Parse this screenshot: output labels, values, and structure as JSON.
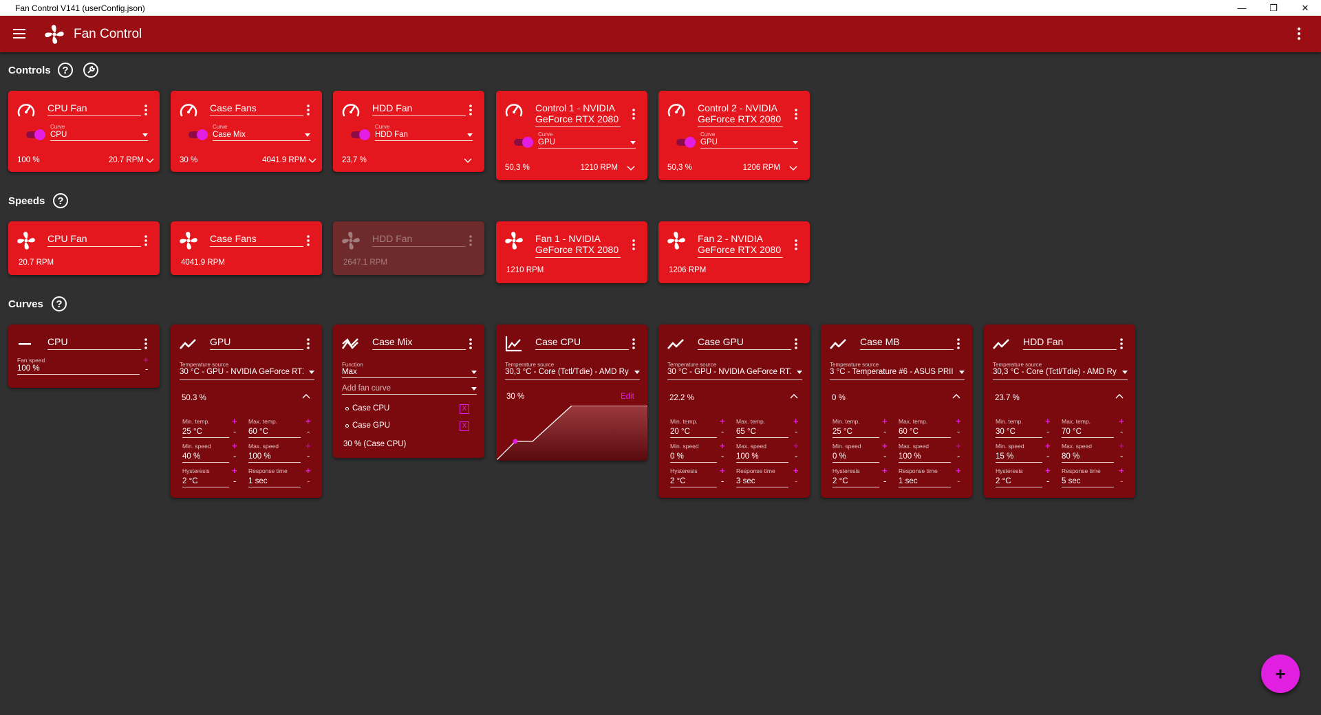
{
  "window": {
    "title": "Fan Control V141 (userConfig.json)"
  },
  "appbar": {
    "title": "Fan Control"
  },
  "sections": {
    "controls": "Controls",
    "speeds": "Speeds",
    "curves": "Curves",
    "help": "?"
  },
  "controls": [
    {
      "name": "CPU Fan",
      "curve_label": "Curve",
      "curve": "CPU",
      "percent": "100 %",
      "rpm": "20.7 RPM"
    },
    {
      "name": "Case Fans",
      "curve_label": "Curve",
      "curve": "Case Mix",
      "percent": "30 %",
      "rpm": "4041.9 RPM"
    },
    {
      "name": "HDD Fan",
      "curve_label": "Curve",
      "curve": "HDD Fan",
      "percent": "23,7 %",
      "rpm": ""
    },
    {
      "name_l1": "Control 1 - NVIDIA",
      "name_l2": "GeForce RTX 2080",
      "curve_label": "Curve",
      "curve": "GPU",
      "percent": "50,3 %",
      "rpm": "1210 RPM"
    },
    {
      "name_l1": "Control 2 - NVIDIA",
      "name_l2": "GeForce RTX 2080",
      "curve_label": "Curve",
      "curve": "GPU",
      "percent": "50,3 %",
      "rpm": "1206 RPM"
    }
  ],
  "speeds": [
    {
      "name": "CPU Fan",
      "rpm": "20.7 RPM"
    },
    {
      "name": "Case Fans",
      "rpm": "4041.9 RPM"
    },
    {
      "name": "HDD Fan",
      "rpm": "2647.1 RPM"
    },
    {
      "name_l1": "Fan 1 - NVIDIA",
      "name_l2": "GeForce RTX 2080",
      "rpm": "1210 RPM"
    },
    {
      "name_l1": "Fan 2 - NVIDIA",
      "name_l2": "GeForce RTX 2080",
      "rpm": "1206 RPM"
    }
  ],
  "curves": {
    "cpu": {
      "name": "CPU",
      "field_label": "Fan speed",
      "value": "100 %"
    },
    "mix": {
      "name": "Case Mix",
      "function_label": "Function",
      "function": "Max",
      "add_placeholder": "Add fan curve",
      "items": [
        "Case CPU",
        "Case GPU"
      ],
      "remove": "X",
      "result": "30 % (Case CPU)"
    },
    "graph": {
      "name": "Case CPU",
      "source_label": "Temperature source",
      "source": "30,3 °C - Core (Tctl/Tdie) - AMD Ry",
      "percent": "30 %",
      "edit": "Edit"
    },
    "linear": [
      {
        "name": "GPU",
        "source": "30 °C - GPU - NVIDIA GeForce RTX",
        "percent": "50.3 %",
        "min_temp": "25 °C",
        "max_temp": "60 °C",
        "min_speed": "40 %",
        "max_speed": "100 %",
        "hysteresis": "2 °C",
        "response": "1 sec"
      },
      {
        "name": "Case GPU",
        "source": "30 °C - GPU - NVIDIA GeForce RTX",
        "percent": "22.2 %",
        "min_temp": "20 °C",
        "max_temp": "65 °C",
        "min_speed": "0 %",
        "max_speed": "100 %",
        "hysteresis": "2 °C",
        "response": "3 sec"
      },
      {
        "name": "Case MB",
        "source": "3 °C - Temperature #6 - ASUS PRII",
        "percent": "0 %",
        "min_temp": "25 °C",
        "max_temp": "60 °C",
        "min_speed": "0 %",
        "max_speed": "100 %",
        "hysteresis": "2 °C",
        "response": "1 sec"
      },
      {
        "name": "HDD Fan",
        "source": "30,3 °C - Core (Tctl/Tdie) - AMD Ry",
        "percent": "23.7 %",
        "min_temp": "30 °C",
        "max_temp": "70 °C",
        "min_speed": "15 %",
        "max_speed": "80 %",
        "hysteresis": "2 °C",
        "response": "5 sec"
      }
    ],
    "labels": {
      "source": "Temperature source",
      "min_temp": "Min. temp.",
      "max_temp": "Max. temp.",
      "min_speed": "Min. speed",
      "max_speed": "Max. speed",
      "hysteresis": "Hysteresis",
      "response": "Response time",
      "plus": "+",
      "minus": "-"
    }
  },
  "fab": {
    "label": "+"
  },
  "colors": {
    "appbar": "#9b0e14",
    "card_bright": "#e3171d",
    "card_dark": "#7b0a0f",
    "accent": "#e01fe0",
    "background": "#303030"
  }
}
